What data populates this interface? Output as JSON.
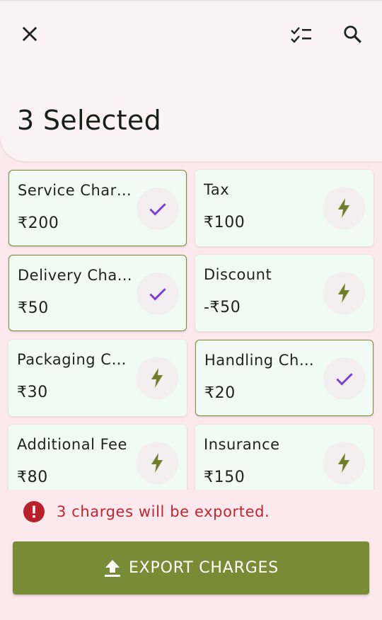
{
  "header": {
    "title": "3 Selected",
    "close_icon": "close-icon",
    "select_all_icon": "checklist-icon",
    "search_icon": "search-icon"
  },
  "charges": [
    {
      "name": "Service Char…",
      "price": "₹200",
      "selected": true
    },
    {
      "name": "Tax",
      "price": "₹100",
      "selected": false
    },
    {
      "name": "Delivery Cha…",
      "price": "₹50",
      "selected": true
    },
    {
      "name": "Discount",
      "price": "-₹50",
      "selected": false
    },
    {
      "name": "Packaging C…",
      "price": "₹30",
      "selected": false
    },
    {
      "name": "Handling Ch…",
      "price": "₹20",
      "selected": true
    },
    {
      "name": "Additional Fee",
      "price": "₹80",
      "selected": false
    },
    {
      "name": "Insurance",
      "price": "₹150",
      "selected": false
    }
  ],
  "status": {
    "text": "3 charges will be exported.",
    "icon": "error-info-icon"
  },
  "export": {
    "label": "EXPORT CHARGES",
    "icon": "upload-icon"
  },
  "colors": {
    "accent": "#7a8b35",
    "check": "#7b3fd6",
    "error": "#c0262d",
    "card_bg": "#f0fbf5",
    "page_bg": "#fbe9ee"
  }
}
